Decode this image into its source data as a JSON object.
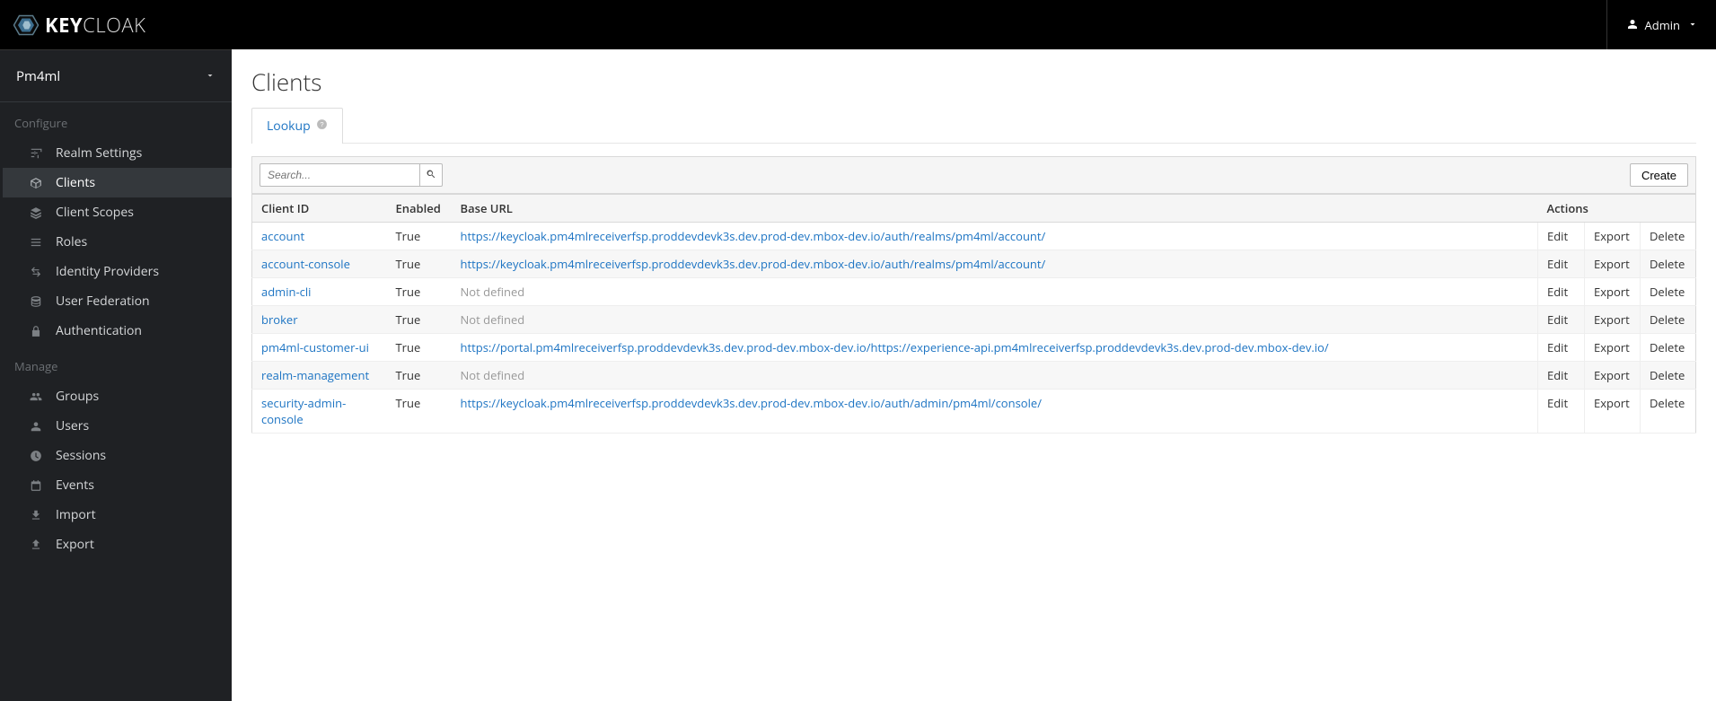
{
  "header": {
    "brand_prefix": "KEY",
    "brand_suffix": "CLOAK",
    "user_label": "Admin"
  },
  "sidebar": {
    "realm": "Pm4ml",
    "sections": {
      "configure_label": "Configure",
      "manage_label": "Manage"
    },
    "configure_items": [
      {
        "label": "Realm Settings"
      },
      {
        "label": "Clients"
      },
      {
        "label": "Client Scopes"
      },
      {
        "label": "Roles"
      },
      {
        "label": "Identity Providers"
      },
      {
        "label": "User Federation"
      },
      {
        "label": "Authentication"
      }
    ],
    "manage_items": [
      {
        "label": "Groups"
      },
      {
        "label": "Users"
      },
      {
        "label": "Sessions"
      },
      {
        "label": "Events"
      },
      {
        "label": "Import"
      },
      {
        "label": "Export"
      }
    ]
  },
  "page": {
    "title": "Clients",
    "tab_label": "Lookup",
    "search_placeholder": "Search...",
    "create_label": "Create",
    "columns": {
      "id": "Client ID",
      "enabled": "Enabled",
      "url": "Base URL",
      "actions": "Actions"
    },
    "actions": {
      "edit": "Edit",
      "export": "Export",
      "delete": "Delete"
    },
    "not_defined": "Not defined",
    "rows": [
      {
        "id": "account",
        "enabled": "True",
        "url": "https://keycloak.pm4mlreceiverfsp.proddevdevk3s.dev.prod-dev.mbox-dev.io/auth/realms/pm4ml/account/"
      },
      {
        "id": "account-console",
        "enabled": "True",
        "url": "https://keycloak.pm4mlreceiverfsp.proddevdevk3s.dev.prod-dev.mbox-dev.io/auth/realms/pm4ml/account/"
      },
      {
        "id": "admin-cli",
        "enabled": "True",
        "url": null
      },
      {
        "id": "broker",
        "enabled": "True",
        "url": null
      },
      {
        "id": "pm4ml-customer-ui",
        "enabled": "True",
        "url": "https://portal.pm4mlreceiverfsp.proddevdevk3s.dev.prod-dev.mbox-dev.io/https://experience-api.pm4mlreceiverfsp.proddevdevk3s.dev.prod-dev.mbox-dev.io/"
      },
      {
        "id": "realm-management",
        "enabled": "True",
        "url": null
      },
      {
        "id": "security-admin-console",
        "enabled": "True",
        "url": "https://keycloak.pm4mlreceiverfsp.proddevdevk3s.dev.prod-dev.mbox-dev.io/auth/admin/pm4ml/console/"
      }
    ]
  }
}
